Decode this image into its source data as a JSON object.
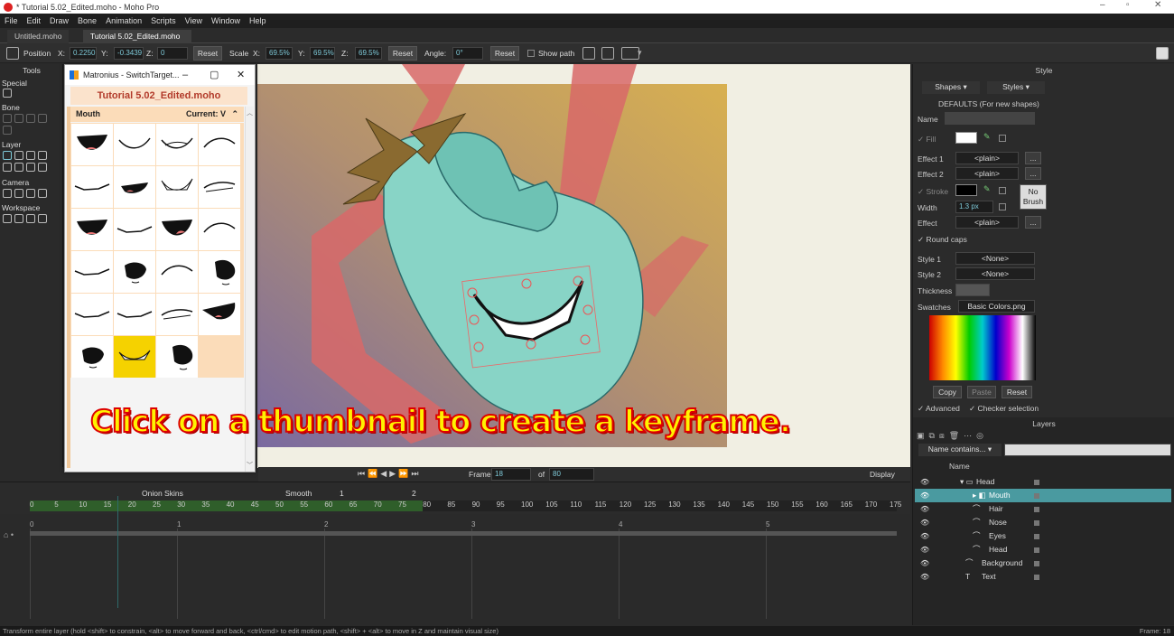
{
  "window": {
    "title": "* Tutorial 5.02_Edited.moho - Moho Pro"
  },
  "menu": [
    "File",
    "Edit",
    "Draw",
    "Bone",
    "Animation",
    "Scripts",
    "View",
    "Window",
    "Help"
  ],
  "tabs": [
    {
      "label": "Untitled.moho"
    },
    {
      "label": "Tutorial 5.02_Edited.moho"
    }
  ],
  "toolbar": {
    "position_label": "Position",
    "x_label": "X:",
    "x": "0.2250",
    "y_label": "Y:",
    "y": "-0.3439",
    "z_label": "Z:",
    "z": "0",
    "reset1": "Reset",
    "scale_label": "Scale",
    "sx_label": "X:",
    "sx": "69.5%",
    "sy_label": "Y:",
    "sy": "69.5%",
    "sz_label": "Z:",
    "sz": "69.5%",
    "reset2": "Reset",
    "angle_label": "Angle:",
    "angle": "0°",
    "reset3": "Reset",
    "show_path": "Show path"
  },
  "tools": {
    "title": "Tools",
    "special": "Special",
    "bone": "Bone",
    "layer": "Layer",
    "camera": "Camera",
    "workspace": "Workspace"
  },
  "switch_window": {
    "title": "Matronius - SwitchTarget...",
    "document": "Tutorial 5.02_Edited.moho",
    "group": "Mouth",
    "current": "Current: V",
    "thumbnails": [
      {
        "shape": "open"
      },
      {
        "shape": "smile"
      },
      {
        "shape": "smile-lip"
      },
      {
        "shape": "smirk"
      },
      {
        "shape": "flat"
      },
      {
        "shape": "open-small"
      },
      {
        "shape": "teeth"
      },
      {
        "shape": "smirk2"
      },
      {
        "shape": "open"
      },
      {
        "shape": "flat"
      },
      {
        "shape": "open-tongue"
      },
      {
        "shape": "smirk"
      },
      {
        "shape": "flat"
      },
      {
        "shape": "blob"
      },
      {
        "shape": "smirk"
      },
      {
        "shape": "blob2"
      },
      {
        "shape": "flat"
      },
      {
        "shape": "flat"
      },
      {
        "shape": "smirk2"
      },
      {
        "shape": "open-side"
      },
      {
        "shape": "blob"
      },
      {
        "shape": "teeth-sel",
        "selected": true
      },
      {
        "shape": "blob2"
      }
    ]
  },
  "caption": "Click on a thumbnail to create a keyframe.",
  "style": {
    "title": "Style",
    "shapes": "Shapes",
    "styles": "Styles",
    "defaults": "DEFAULTS (For new shapes)",
    "name_label": "Name",
    "fill_label": "Fill",
    "effect1_label": "Effect 1",
    "effect1": "<plain>",
    "effect2_label": "Effect 2",
    "effect2": "<plain>",
    "stroke_label": "Stroke",
    "no_brush": "No Brush",
    "width_label": "Width",
    "width": "1.3 px",
    "effect_label": "Effect",
    "effect": "<plain>",
    "round_caps": "Round caps",
    "style1_label": "Style 1",
    "style1": "<None>",
    "style2_label": "Style 2",
    "style2": "<None>",
    "thickness_label": "Thickness",
    "swatches_label": "Swatches",
    "swatches": "Basic Colors.png",
    "copy": "Copy",
    "paste": "Paste",
    "reset": "Reset",
    "advanced": "Advanced",
    "checker": "Checker selection",
    "fill_color": "#ffffff",
    "stroke_color": "#000000"
  },
  "layers": {
    "title": "Layers",
    "filter": "Name contains...",
    "name_col": "Name",
    "rows": [
      {
        "name": "Head",
        "type": "group"
      },
      {
        "name": "Mouth",
        "type": "switch",
        "selected": true
      },
      {
        "name": "Hair",
        "type": "vector"
      },
      {
        "name": "Nose",
        "type": "vector"
      },
      {
        "name": "Eyes",
        "type": "vector"
      },
      {
        "name": "Head",
        "type": "vector"
      },
      {
        "name": "Background",
        "type": "vector"
      },
      {
        "name": "Text",
        "type": "text"
      }
    ]
  },
  "playback": {
    "frame_label": "Frame",
    "frame": "18",
    "of_label": "of",
    "total": "80",
    "display": "Display"
  },
  "timeline": {
    "onion": "Onion Skins",
    "smooth": "Smooth",
    "one": "1",
    "two": "2",
    "ruler": [
      "0",
      "5",
      "10",
      "15",
      "20",
      "25",
      "30",
      "35",
      "40",
      "45",
      "50",
      "55",
      "60",
      "65",
      "70",
      "75",
      "80",
      "85",
      "90",
      "95",
      "100",
      "105",
      "110",
      "115",
      "120",
      "125",
      "130",
      "135",
      "140",
      "145",
      "150",
      "155",
      "160",
      "165",
      "170",
      "175"
    ],
    "seconds": [
      "0",
      "1",
      "2",
      "3",
      "4",
      "5"
    ]
  },
  "status": {
    "hint": "Transform entire layer (hold <shift> to constrain, <alt> to move forward and back, <ctrl/cmd> to edit motion path, <shift> + <alt> to move in Z and maintain visual size)",
    "frame": "Frame: 18"
  }
}
